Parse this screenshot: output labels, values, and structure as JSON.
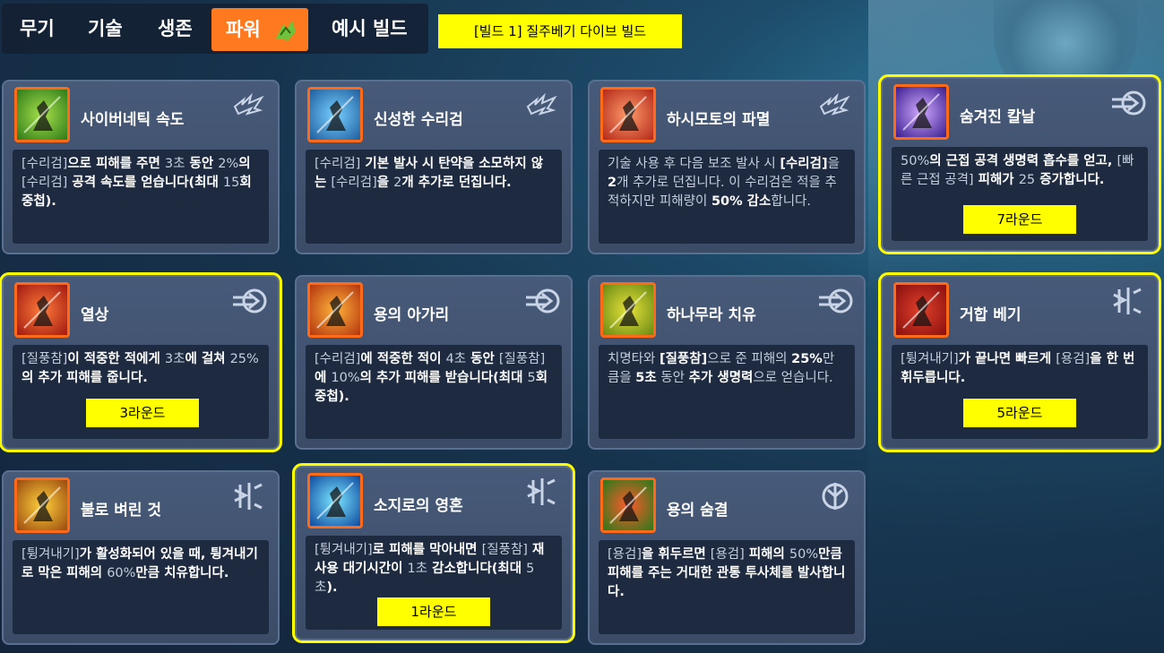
{
  "tabs": [
    {
      "label": "무기"
    },
    {
      "label": "기술"
    },
    {
      "label": "생존"
    },
    {
      "label": "파워"
    },
    {
      "label": "예시 빌드"
    }
  ],
  "build_label": "[빌드 1] 질주베기 다이브 빌드",
  "cards": [
    {
      "title": "사이버네틱 속도",
      "icon": "cyber-speed-icon",
      "corner": "shuriken-icon",
      "desc": [
        "[수리검]",
        "으로 피해를 주면 ",
        "3초",
        " 동안 ",
        "2%",
        "의 ",
        "[수리검]",
        " 공격 속도를 얻습니다(최대 ",
        "15",
        "회 중첩)."
      ]
    },
    {
      "title": "신성한 수리검",
      "icon": "sacred-shuriken-icon",
      "corner": "shuriken-icon",
      "desc": [
        "[수리검]",
        " 기본 발사 시 탄약을 소모하지 않는 ",
        "[수리검]",
        "을 ",
        "2",
        "개 추가로 던집니다."
      ]
    },
    {
      "title": "하시모토의 파멸",
      "icon": "hashimoto-ruin-icon",
      "corner": "shuriken-icon",
      "desc": [
        "기술 사용 후 다음 보조 발사 시 ",
        "[수리검]",
        "을 ",
        "2",
        "개 추가로 던집니다. 이 수리검은 적을 추적하지만 피해량이 ",
        "50% 감소",
        "합니다."
      ]
    },
    {
      "title": "숨겨진 칼날",
      "icon": "hidden-blade-icon",
      "corner": "swift-strike-icon",
      "desc": [
        "50%",
        "의 근접 공격 생명력 흡수를 얻고, ",
        "[빠른 근접 공격]",
        " 피해가 ",
        "25",
        " 증가합니다."
      ],
      "round": "7라운드"
    },
    {
      "title": "열상",
      "icon": "laceration-icon",
      "corner": "swift-strike-icon",
      "desc": [
        "[질풍참]",
        "이 적중한 적에게 ",
        "3초",
        "에 걸쳐 ",
        "25%",
        "의 추가 피해를 줍니다."
      ],
      "round": "3라운드"
    },
    {
      "title": "용의 아가리",
      "icon": "dragon-maw-icon",
      "corner": "swift-strike-icon",
      "desc": [
        "[수리검]",
        "에 적중한 적이 ",
        "4초",
        " 동안 ",
        "[질풍참]",
        "에 ",
        "10%",
        "의 추가 피해를 받습니다(최대 ",
        "5",
        "회 중첩)."
      ]
    },
    {
      "title": "하나무라 치유",
      "icon": "hanamura-healing-icon",
      "corner": "swift-strike-icon",
      "desc": [
        "치명타와 ",
        "[질풍참]",
        "으로 준 피해의 ",
        "25%",
        "만큼을 ",
        "5초",
        " 동안 ",
        "추가 생명력",
        "으로 얻습니다."
      ]
    },
    {
      "title": "거합 베기",
      "icon": "iaido-strike-icon",
      "corner": "deflect-icon",
      "desc": [
        "[튕겨내기]",
        "가 끝나면 빠르게 ",
        "[용검]",
        "을 한 번 휘두릅니다."
      ],
      "round": "5라운드"
    },
    {
      "title": "불로 벼린 것",
      "icon": "forged-in-fire-icon",
      "corner": "deflect-icon",
      "desc": [
        "[튕겨내기]",
        "가 활성화되어 있을 때, 튕겨내기로 막은 피해의 ",
        "60%",
        "만큼 치유합니다."
      ]
    },
    {
      "title": "소지로의 영혼",
      "icon": "sojiro-spirit-icon",
      "corner": "deflect-icon",
      "desc": [
        "[튕겨내기]",
        "로 피해를 막아내면 ",
        "[질풍참]",
        " 재사용 대기시간이 ",
        "1초",
        " 감소합니다(최대 ",
        "5초",
        ")."
      ],
      "round": "1라운드"
    },
    {
      "title": "용의 숨결",
      "icon": "dragon-breath-icon",
      "corner": "dragonblade-icon",
      "desc": [
        "[용검]",
        "을 휘두르면 ",
        "[용검]",
        " 피해의 ",
        "50%",
        "만큼 피해를 주는 거대한 관통 투사체를 발사합니다."
      ]
    }
  ],
  "colors": {
    "accent": "#ff7a1f",
    "highlight": "#ffff00",
    "card_bg": "#3e5070",
    "desc_bg": "#1d2a40"
  }
}
